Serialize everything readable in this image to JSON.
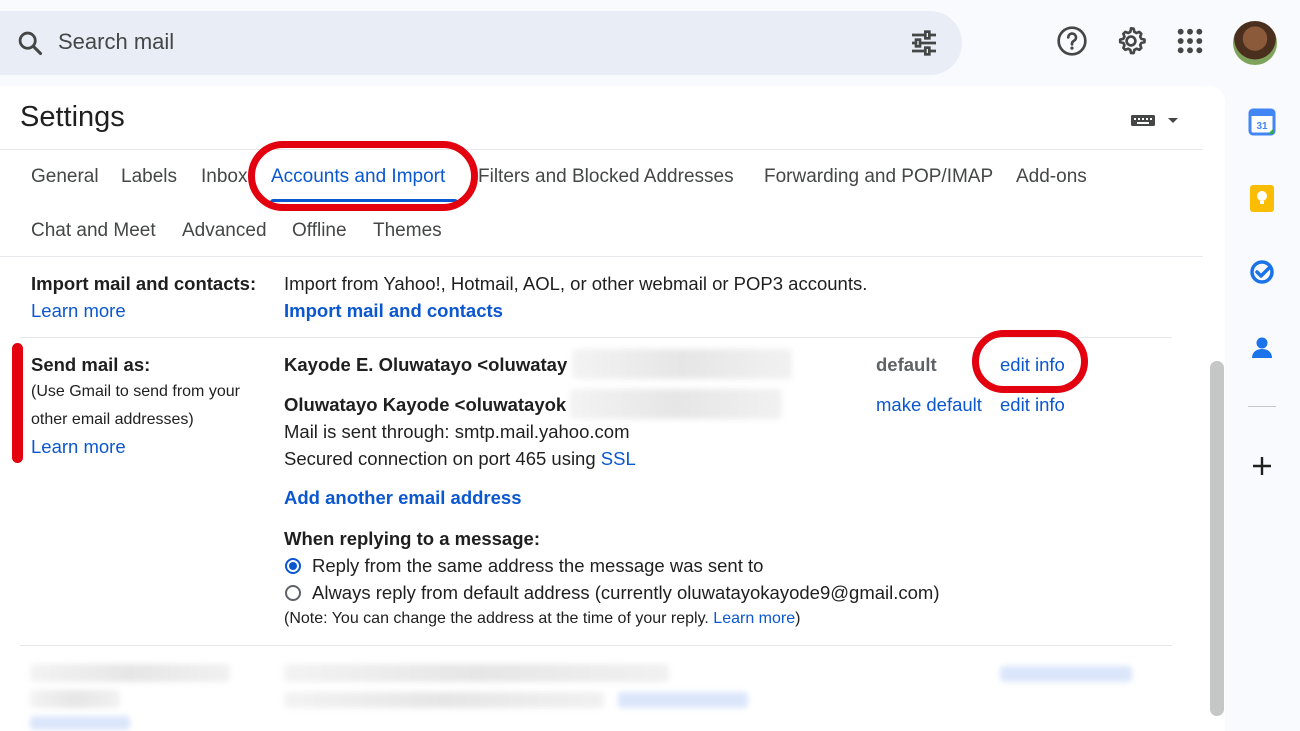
{
  "search": {
    "placeholder": "Search mail"
  },
  "settings": {
    "title": "Settings",
    "tabs_row1": [
      "General",
      "Labels",
      "Inbox",
      "Accounts and Import",
      "Filters and Blocked Addresses",
      "Forwarding and POP/IMAP",
      "Add-ons"
    ],
    "tabs_row2": [
      "Chat and Meet",
      "Advanced",
      "Offline",
      "Themes"
    ],
    "active_tab": "Accounts and Import"
  },
  "import_section": {
    "label": "Import mail and contacts:",
    "learn_more": "Learn more",
    "description": "Import from Yahoo!, Hotmail, AOL, or other webmail or POP3 accounts.",
    "action": "Import mail and contacts"
  },
  "send_mail_as": {
    "label": "Send mail as:",
    "help_line1": "(Use Gmail to send from your",
    "help_line2": "other email addresses)",
    "learn_more": "Learn more",
    "accounts": [
      {
        "name": "Kayode E. Oluwatayo <oluwatay",
        "status": "default",
        "edit": "edit info"
      },
      {
        "name": "Oluwatayo Kayode <oluwatayok",
        "make_default": "make default",
        "edit": "edit info",
        "sent_through": "Mail is sent through: smtp.mail.yahoo.com",
        "secured_prefix": "Secured connection on port 465 using ",
        "ssl": "SSL"
      }
    ],
    "add_address": "Add another email address",
    "reply_heading": "When replying to a message:",
    "reply_option1": "Reply from the same address the message was sent to",
    "reply_option2": "Always reply from default address (currently oluwatayokayode9@gmail.com)",
    "note_prefix": "(Note: You can change the address at the time of your reply. ",
    "note_link": "Learn more",
    "note_suffix": ")"
  },
  "colors": {
    "accent": "#0b57d0",
    "annotation": "#e3000f"
  },
  "icons": [
    "search-icon",
    "filter-options-icon",
    "help-icon",
    "settings-gear-icon",
    "apps-grid-icon",
    "keyboard-icon",
    "calendar-icon",
    "keep-icon",
    "tasks-icon",
    "contacts-icon",
    "plus-icon"
  ]
}
